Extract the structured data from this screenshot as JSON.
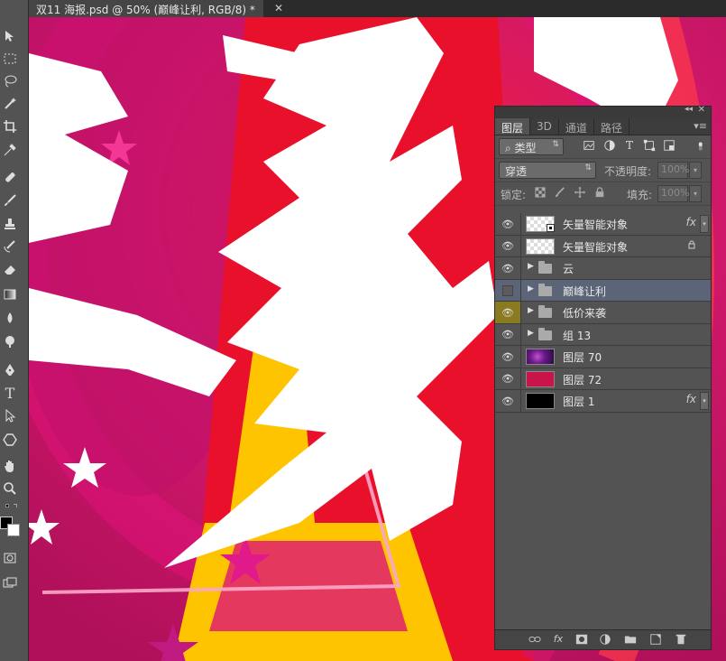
{
  "document": {
    "tab_title": "双11 海报.psd @ 50% (巅峰让利, RGB/8) *",
    "close_glyph": "✕"
  },
  "tools": [
    "move-tool",
    "marquee-tool",
    "lasso-tool",
    "magic-wand-tool",
    "crop-tool",
    "eyedropper-tool",
    "healing-brush-tool",
    "brush-tool",
    "clone-stamp-tool",
    "history-brush-tool",
    "eraser-tool",
    "gradient-tool",
    "blur-tool",
    "dodge-tool",
    "pen-tool",
    "type-tool",
    "path-selection-tool",
    "shape-tool",
    "hand-tool",
    "zoom-tool"
  ],
  "tool_glyphs": {
    "type": "T"
  },
  "colors": {
    "foreground": "#000000",
    "background": "#ffffff"
  },
  "layers_panel": {
    "tabs": [
      "图层",
      "3D",
      "通道",
      "路径"
    ],
    "active_tab": "图层",
    "filter_kind": "类型",
    "blend_mode": "穿透",
    "opacity_label": "不透明度:",
    "opacity_value": "100%",
    "lock_label": "锁定:",
    "fill_label": "填充:",
    "fill_value": "100%",
    "layers": [
      {
        "name": "矢量智能对象",
        "kind": "smart",
        "thumb": "checker",
        "visible": true,
        "fx": true
      },
      {
        "name": "矢量智能对象",
        "kind": "smart",
        "thumb": "checker",
        "visible": true,
        "locked": true
      },
      {
        "name": "云",
        "kind": "group",
        "visible": true
      },
      {
        "name": "巅峰让利",
        "kind": "group",
        "visible": false,
        "selected": true
      },
      {
        "name": "低价来袭",
        "kind": "group",
        "visible": true,
        "highlight": true
      },
      {
        "name": "组 13",
        "kind": "group",
        "visible": true
      },
      {
        "name": "图层 70",
        "kind": "pixel",
        "thumb": "purple",
        "visible": true
      },
      {
        "name": "图层 72",
        "kind": "pixel",
        "thumb": "red",
        "visible": true
      },
      {
        "name": "图层 1",
        "kind": "pixel",
        "thumb": "black",
        "visible": true,
        "fx": true
      }
    ],
    "fx_label": "fx"
  },
  "accent_colors": {
    "canvas_magenta": "#d2186a",
    "canvas_red": "#e8102a",
    "canvas_yellow": "#ffc400"
  }
}
